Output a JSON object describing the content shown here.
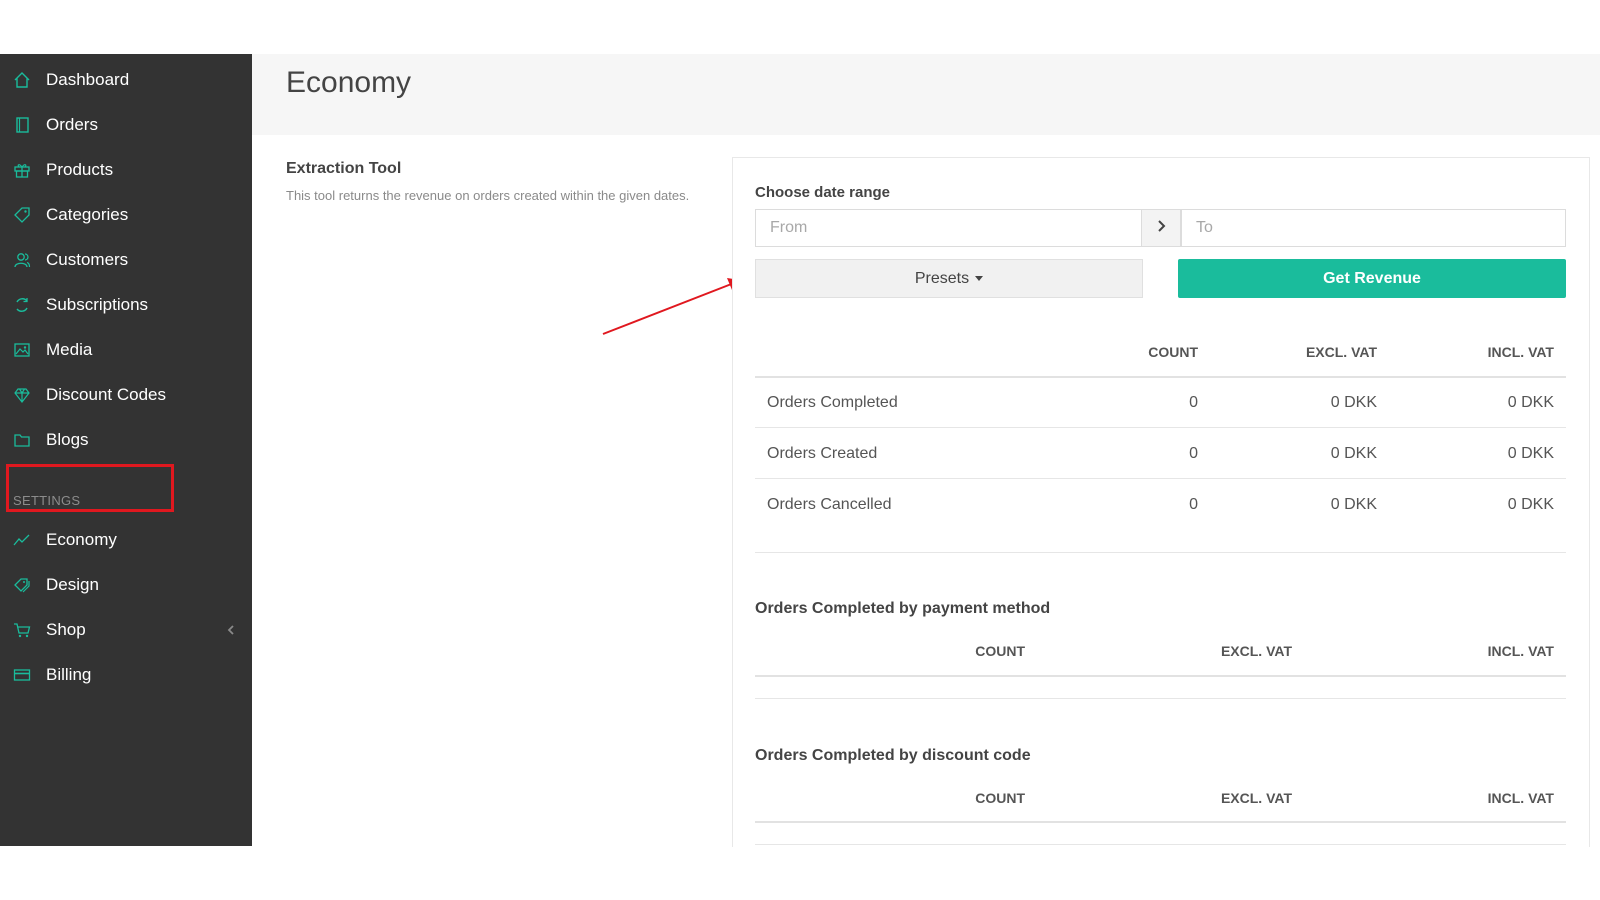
{
  "sidebar": {
    "items": [
      {
        "label": "Dashboard",
        "icon": "home-icon"
      },
      {
        "label": "Orders",
        "icon": "book-icon"
      },
      {
        "label": "Products",
        "icon": "gift-icon"
      },
      {
        "label": "Categories",
        "icon": "tag-icon"
      },
      {
        "label": "Customers",
        "icon": "users-icon"
      },
      {
        "label": "Subscriptions",
        "icon": "refresh-icon"
      },
      {
        "label": "Media",
        "icon": "image-icon"
      },
      {
        "label": "Discount Codes",
        "icon": "diamond-icon"
      },
      {
        "label": "Blogs",
        "icon": "folder-icon"
      }
    ],
    "settings_heading": "SETTINGS",
    "settings_items": [
      {
        "label": "Economy",
        "icon": "chart-line-icon",
        "active": true
      },
      {
        "label": "Design",
        "icon": "tags-icon"
      },
      {
        "label": "Shop",
        "icon": "cart-icon"
      },
      {
        "label": "Billing",
        "icon": "credit-card-icon"
      }
    ]
  },
  "header": {
    "title": "Economy"
  },
  "tool": {
    "title": "Extraction Tool",
    "description": "This tool returns the revenue on orders created within the given dates."
  },
  "range": {
    "label": "Choose date range",
    "from_placeholder": "From",
    "to_placeholder": "To",
    "presets_label": "Presets",
    "get_revenue_label": "Get Revenue"
  },
  "summary_table": {
    "headers": [
      "COUNT",
      "EXCL. VAT",
      "INCL. VAT"
    ],
    "rows": [
      {
        "label": "Orders Completed",
        "count": "0",
        "excl": "0 DKK",
        "incl": "0 DKK"
      },
      {
        "label": "Orders Created",
        "count": "0",
        "excl": "0 DKK",
        "incl": "0 DKK"
      },
      {
        "label": "Orders Cancelled",
        "count": "0",
        "excl": "0 DKK",
        "incl": "0 DKK"
      }
    ]
  },
  "payment_table": {
    "title": "Orders Completed by payment method",
    "headers": [
      "COUNT",
      "EXCL. VAT",
      "INCL. VAT"
    ]
  },
  "discount_table": {
    "title": "Orders Completed by discount code",
    "headers": [
      "COUNT",
      "EXCL. VAT",
      "INCL. VAT"
    ]
  },
  "colors": {
    "sidebar_bg": "#333333",
    "accent": "#1abc9c",
    "annotation": "#e0181f"
  }
}
